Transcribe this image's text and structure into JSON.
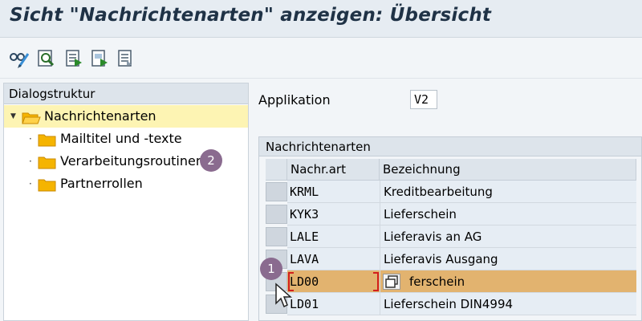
{
  "window": {
    "title": "Sicht \"Nachrichtenarten\" anzeigen: Übersicht"
  },
  "toolbar": {
    "buttons": [
      {
        "icon": "glasses-edit-icon"
      },
      {
        "icon": "find-icon"
      },
      {
        "icon": "select-all-icon"
      },
      {
        "icon": "select-block-icon"
      },
      {
        "icon": "deselect-all-icon"
      }
    ]
  },
  "dialog_structure": {
    "header": "Dialogstruktur",
    "items": [
      {
        "label": "Nachrichtenarten",
        "selected": true
      },
      {
        "label": "Mailtitel und -texte"
      },
      {
        "label": "Verarbeitungsroutinen"
      },
      {
        "label": "Partnerrollen"
      }
    ]
  },
  "application": {
    "label": "Applikation",
    "value": "V2"
  },
  "group": {
    "title": "Nachrichtenarten"
  },
  "table": {
    "columns": [
      "Nachr.art",
      "Bezeichnung"
    ],
    "rows": [
      {
        "key": "KRML",
        "desc": "Kreditbearbeitung"
      },
      {
        "key": "KYK3",
        "desc": "Lieferschein"
      },
      {
        "key": "LALE",
        "desc": "Lieferavis an AG"
      },
      {
        "key": "LAVA",
        "desc": "Lieferavis Ausgang"
      },
      {
        "key": "LD00",
        "desc": "ferschein",
        "highlighted": true
      },
      {
        "key": "LD01",
        "desc": "Lieferschein DIN4994"
      }
    ]
  },
  "annotations": {
    "badge_1": "1",
    "badge_2": "2"
  },
  "colors": {
    "selected_tree_row": "#fdf4b3",
    "highlighted_row": "#e2b36f",
    "badge": "#8a6b8f",
    "bracket": "#d2201e",
    "folder": "#f5b400"
  }
}
